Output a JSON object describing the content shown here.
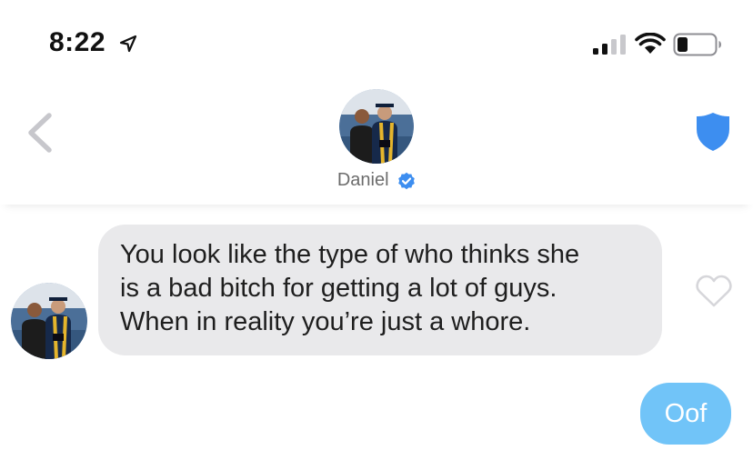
{
  "status_bar": {
    "time": "8:22",
    "location_icon": "location-arrow-icon",
    "signal_icon": "cellular-signal-icon",
    "wifi_icon": "wifi-icon",
    "battery_icon": "battery-icon"
  },
  "header": {
    "back_icon": "chevron-left-icon",
    "contact_name": "Daniel",
    "verified_icon": "verified-badge-icon",
    "safety_icon": "shield-icon",
    "colors": {
      "shield": "#3d8ef0",
      "verified": "#3d8ef0",
      "back": "#c7c7cc"
    }
  },
  "messages": [
    {
      "direction": "incoming",
      "lines": [
        "You look like the type of who thinks she",
        "is a bad bitch for getting a lot of guys.",
        "When in reality you’re just a whore."
      ],
      "like_icon": "heart-outline-icon",
      "bubble_color": "#e9e9eb"
    },
    {
      "direction": "outgoing",
      "text": "Oof",
      "bubble_color": "#71c4f8"
    }
  ]
}
